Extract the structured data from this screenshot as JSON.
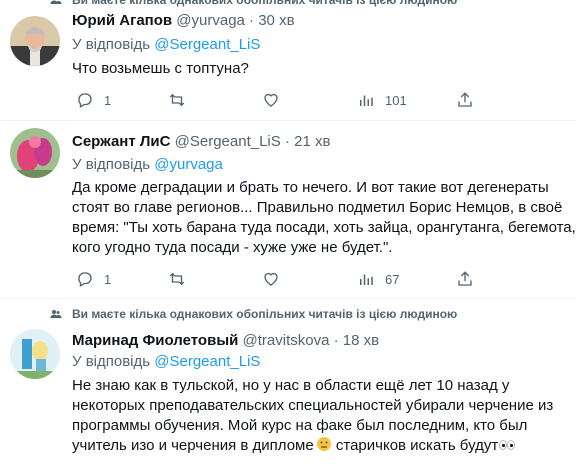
{
  "social_context_text": "Ви маєте кілька однакових обопільних читачів із цією людиною",
  "reply_prefix": "У відповідь",
  "dot": "·",
  "tweets": [
    {
      "name": "Юрий Агапов",
      "handle": "@yurvaga",
      "time": "30 хв",
      "reply_to": "@Sergeant_LiS",
      "lines": [
        "Что возьмешь с топтуна?"
      ],
      "replies": "1",
      "retweets": "",
      "likes": "",
      "views": "101"
    },
    {
      "name": "Сержант ЛиС",
      "handle": "@Sergeant_LiS",
      "time": "21 хв",
      "reply_to": "@yurvaga",
      "lines": [
        "Да кроме деградации и брать то нечего. И вот такие вот дегенераты",
        "стоят во главе регионов... Правильно подметил Борис Немцов, в своё",
        "время: \"Ты хоть барана туда посади, хоть зайца, орангутанга, бегемота,",
        "кого угодно туда посади - хуже уже не будет.\"."
      ],
      "replies": "1",
      "retweets": "",
      "likes": "",
      "views": "67"
    },
    {
      "name": "Маринад Фиолетовый",
      "handle": "@travitskova",
      "time": "18 хв",
      "reply_to": "@Sergeant_LiS",
      "lines": [
        "Не знаю как в тульской, но у нас в  области ещё лет 10 назад у",
        "некоторых преподавательских специальностей убирали черчение из",
        "программы обучения. Мой курс на факе был последним, кто был",
        "учитель изо и черчения в дипломе",
        " старичков искать будут"
      ]
    }
  ],
  "icons": [
    "reply-icon",
    "retweet-icon",
    "like-icon",
    "views-icon",
    "share-icon",
    "people-icon"
  ],
  "colors": {
    "accent": "#1d9bf0",
    "muted": "#536471",
    "text": "#0f1419",
    "divider": "#eff3f4"
  }
}
